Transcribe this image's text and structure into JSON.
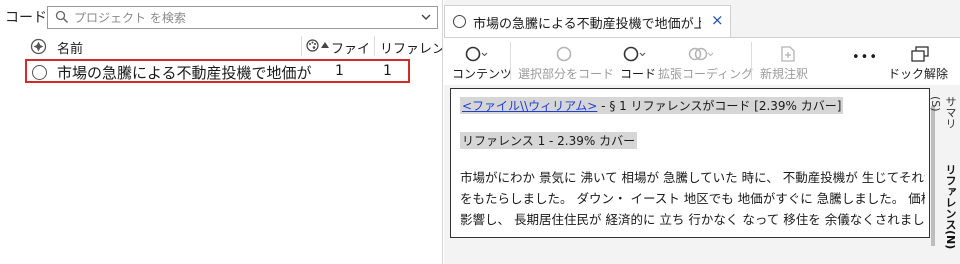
{
  "left_pane": {
    "title": "コード",
    "search": {
      "placeholder": "プロジェクト を検索",
      "value": ""
    },
    "columns": {
      "name": "名前",
      "files": "ファイ",
      "references": "リファレン"
    },
    "rows": [
      {
        "name": "市場の急騰による不動産投機で地価が",
        "files": "1",
        "references": "1"
      }
    ]
  },
  "tab": {
    "label": "市場の急騰による不動産投機で地価が上昇し、",
    "close": "×"
  },
  "toolbar": {
    "contents": "コンテンツ",
    "code_selection": "選択部分をコード",
    "code": "コード",
    "extended_coding": "拡張コーディング",
    "new_memo": "新規注釈",
    "more": "•••",
    "undock": "ドック解除"
  },
  "document": {
    "link": "<ファイル\\\\ウィリアム>",
    "link_suffix": " - § 1 リファレンスがコード  [2.39% カバー]",
    "reference_header": "リファレンス 1 - 2.39% カバー",
    "lines": [
      "市場がにわか 景気に 沸いて 相場が 急騰していた 時に、 不動産投機が 生じてそれが 今の",
      "をもたらしました。 ダウン・ イースト 地区でも 地価がすぐに 急騰しました。 価格の 高",
      "影響し、 長期居住住民が 経済的に 立ち 行かなく なって 移住を 余儀なくされました。"
    ]
  },
  "side_tabs": {
    "summary": "サマリ (S)",
    "reference": "リファレンス(N)"
  },
  "colors": {
    "highlight_border": "#d42a2a",
    "link": "#1f3fd1",
    "close": "#1f4fb4"
  }
}
